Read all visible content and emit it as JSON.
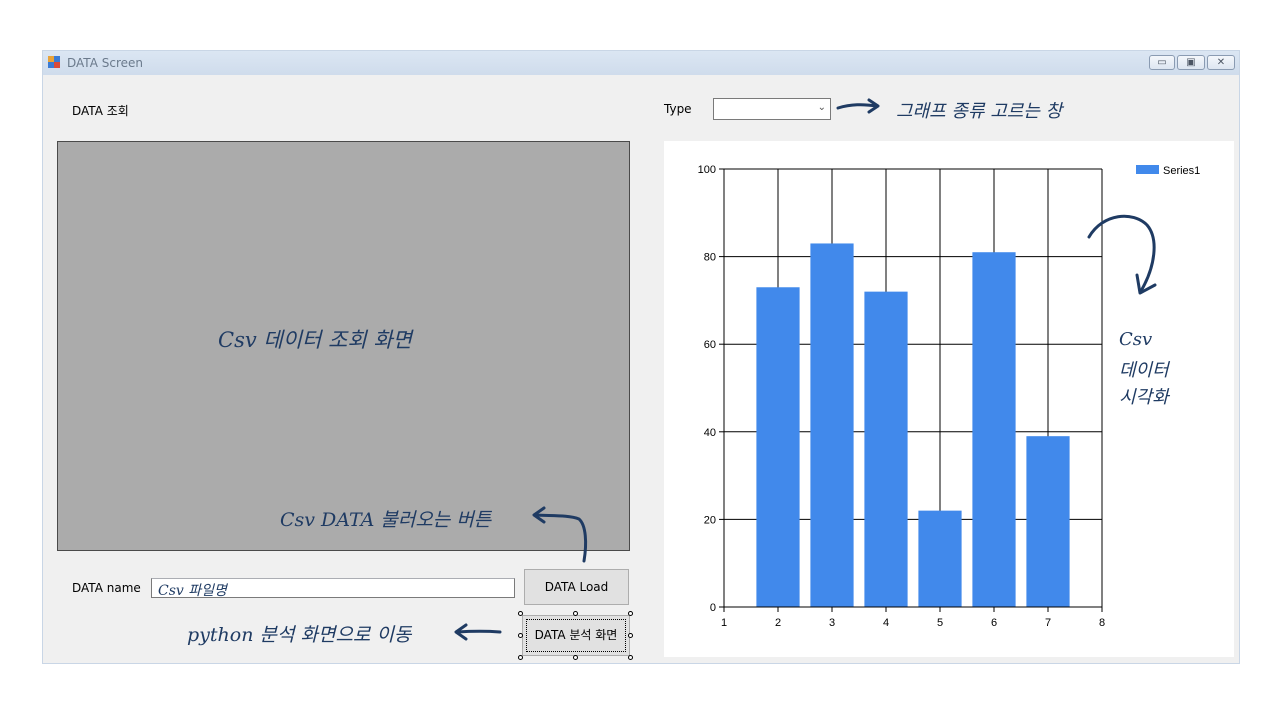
{
  "window": {
    "title": "DATA Screen"
  },
  "left": {
    "section_label": "DATA 조회",
    "grid_note": "Csv 데이터 조회 화면",
    "name_label": "DATA name",
    "name_value": "Csv 파일명",
    "load_button": "DATA Load",
    "analysis_button": "DATA 분석 화면",
    "load_note": "Csv DATA 불러오는 버튼",
    "analysis_note": "python 분석 화면으로 이동"
  },
  "right": {
    "type_label": "Type",
    "type_value": "",
    "type_note": "그래프 종류 고르는 창",
    "chart_note_lines": [
      "Csv",
      "데이터",
      "시각화"
    ]
  },
  "chart_data": {
    "type": "bar",
    "x": [
      2,
      3,
      4,
      5,
      6,
      7
    ],
    "series": [
      {
        "name": "Series1",
        "values": [
          73,
          83,
          72,
          22,
          81,
          39
        ]
      }
    ],
    "xlim": [
      1,
      8
    ],
    "ylim": [
      0,
      100
    ],
    "x_ticks": [
      "1",
      "2",
      "3",
      "4",
      "5",
      "6",
      "7",
      "8"
    ],
    "y_ticks": [
      "0",
      "20",
      "40",
      "60",
      "80",
      "100"
    ],
    "grid": true,
    "legend": "top-right",
    "bar_color": "#4189eb"
  }
}
